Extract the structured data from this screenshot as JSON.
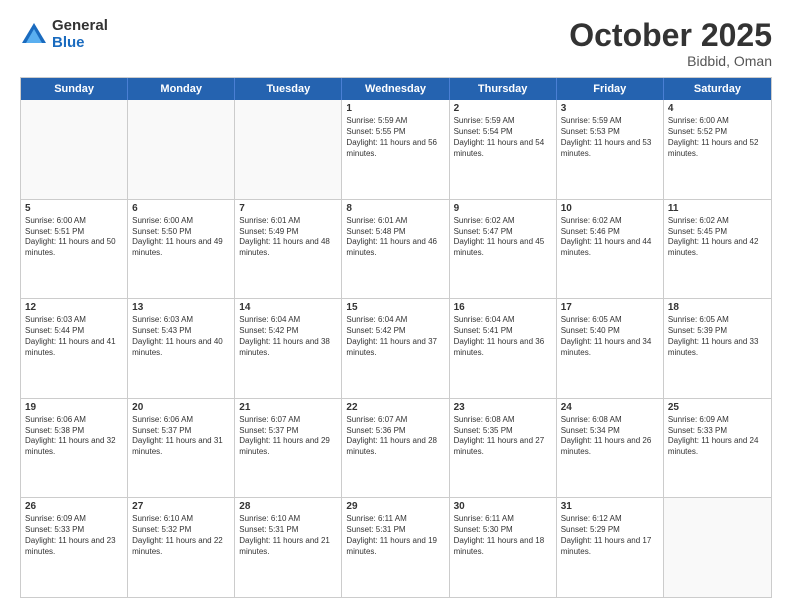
{
  "logo": {
    "general": "General",
    "blue": "Blue"
  },
  "header": {
    "month": "October 2025",
    "location": "Bidbid, Oman"
  },
  "days": [
    "Sunday",
    "Monday",
    "Tuesday",
    "Wednesday",
    "Thursday",
    "Friday",
    "Saturday"
  ],
  "weeks": [
    [
      {
        "day": "",
        "empty": true
      },
      {
        "day": "",
        "empty": true
      },
      {
        "day": "",
        "empty": true
      },
      {
        "day": "1",
        "sunrise": "Sunrise: 5:59 AM",
        "sunset": "Sunset: 5:55 PM",
        "daylight": "Daylight: 11 hours and 56 minutes."
      },
      {
        "day": "2",
        "sunrise": "Sunrise: 5:59 AM",
        "sunset": "Sunset: 5:54 PM",
        "daylight": "Daylight: 11 hours and 54 minutes."
      },
      {
        "day": "3",
        "sunrise": "Sunrise: 5:59 AM",
        "sunset": "Sunset: 5:53 PM",
        "daylight": "Daylight: 11 hours and 53 minutes."
      },
      {
        "day": "4",
        "sunrise": "Sunrise: 6:00 AM",
        "sunset": "Sunset: 5:52 PM",
        "daylight": "Daylight: 11 hours and 52 minutes."
      }
    ],
    [
      {
        "day": "5",
        "sunrise": "Sunrise: 6:00 AM",
        "sunset": "Sunset: 5:51 PM",
        "daylight": "Daylight: 11 hours and 50 minutes."
      },
      {
        "day": "6",
        "sunrise": "Sunrise: 6:00 AM",
        "sunset": "Sunset: 5:50 PM",
        "daylight": "Daylight: 11 hours and 49 minutes."
      },
      {
        "day": "7",
        "sunrise": "Sunrise: 6:01 AM",
        "sunset": "Sunset: 5:49 PM",
        "daylight": "Daylight: 11 hours and 48 minutes."
      },
      {
        "day": "8",
        "sunrise": "Sunrise: 6:01 AM",
        "sunset": "Sunset: 5:48 PM",
        "daylight": "Daylight: 11 hours and 46 minutes."
      },
      {
        "day": "9",
        "sunrise": "Sunrise: 6:02 AM",
        "sunset": "Sunset: 5:47 PM",
        "daylight": "Daylight: 11 hours and 45 minutes."
      },
      {
        "day": "10",
        "sunrise": "Sunrise: 6:02 AM",
        "sunset": "Sunset: 5:46 PM",
        "daylight": "Daylight: 11 hours and 44 minutes."
      },
      {
        "day": "11",
        "sunrise": "Sunrise: 6:02 AM",
        "sunset": "Sunset: 5:45 PM",
        "daylight": "Daylight: 11 hours and 42 minutes."
      }
    ],
    [
      {
        "day": "12",
        "sunrise": "Sunrise: 6:03 AM",
        "sunset": "Sunset: 5:44 PM",
        "daylight": "Daylight: 11 hours and 41 minutes."
      },
      {
        "day": "13",
        "sunrise": "Sunrise: 6:03 AM",
        "sunset": "Sunset: 5:43 PM",
        "daylight": "Daylight: 11 hours and 40 minutes."
      },
      {
        "day": "14",
        "sunrise": "Sunrise: 6:04 AM",
        "sunset": "Sunset: 5:42 PM",
        "daylight": "Daylight: 11 hours and 38 minutes."
      },
      {
        "day": "15",
        "sunrise": "Sunrise: 6:04 AM",
        "sunset": "Sunset: 5:42 PM",
        "daylight": "Daylight: 11 hours and 37 minutes."
      },
      {
        "day": "16",
        "sunrise": "Sunrise: 6:04 AM",
        "sunset": "Sunset: 5:41 PM",
        "daylight": "Daylight: 11 hours and 36 minutes."
      },
      {
        "day": "17",
        "sunrise": "Sunrise: 6:05 AM",
        "sunset": "Sunset: 5:40 PM",
        "daylight": "Daylight: 11 hours and 34 minutes."
      },
      {
        "day": "18",
        "sunrise": "Sunrise: 6:05 AM",
        "sunset": "Sunset: 5:39 PM",
        "daylight": "Daylight: 11 hours and 33 minutes."
      }
    ],
    [
      {
        "day": "19",
        "sunrise": "Sunrise: 6:06 AM",
        "sunset": "Sunset: 5:38 PM",
        "daylight": "Daylight: 11 hours and 32 minutes."
      },
      {
        "day": "20",
        "sunrise": "Sunrise: 6:06 AM",
        "sunset": "Sunset: 5:37 PM",
        "daylight": "Daylight: 11 hours and 31 minutes."
      },
      {
        "day": "21",
        "sunrise": "Sunrise: 6:07 AM",
        "sunset": "Sunset: 5:37 PM",
        "daylight": "Daylight: 11 hours and 29 minutes."
      },
      {
        "day": "22",
        "sunrise": "Sunrise: 6:07 AM",
        "sunset": "Sunset: 5:36 PM",
        "daylight": "Daylight: 11 hours and 28 minutes."
      },
      {
        "day": "23",
        "sunrise": "Sunrise: 6:08 AM",
        "sunset": "Sunset: 5:35 PM",
        "daylight": "Daylight: 11 hours and 27 minutes."
      },
      {
        "day": "24",
        "sunrise": "Sunrise: 6:08 AM",
        "sunset": "Sunset: 5:34 PM",
        "daylight": "Daylight: 11 hours and 26 minutes."
      },
      {
        "day": "25",
        "sunrise": "Sunrise: 6:09 AM",
        "sunset": "Sunset: 5:33 PM",
        "daylight": "Daylight: 11 hours and 24 minutes."
      }
    ],
    [
      {
        "day": "26",
        "sunrise": "Sunrise: 6:09 AM",
        "sunset": "Sunset: 5:33 PM",
        "daylight": "Daylight: 11 hours and 23 minutes."
      },
      {
        "day": "27",
        "sunrise": "Sunrise: 6:10 AM",
        "sunset": "Sunset: 5:32 PM",
        "daylight": "Daylight: 11 hours and 22 minutes."
      },
      {
        "day": "28",
        "sunrise": "Sunrise: 6:10 AM",
        "sunset": "Sunset: 5:31 PM",
        "daylight": "Daylight: 11 hours and 21 minutes."
      },
      {
        "day": "29",
        "sunrise": "Sunrise: 6:11 AM",
        "sunset": "Sunset: 5:31 PM",
        "daylight": "Daylight: 11 hours and 19 minutes."
      },
      {
        "day": "30",
        "sunrise": "Sunrise: 6:11 AM",
        "sunset": "Sunset: 5:30 PM",
        "daylight": "Daylight: 11 hours and 18 minutes."
      },
      {
        "day": "31",
        "sunrise": "Sunrise: 6:12 AM",
        "sunset": "Sunset: 5:29 PM",
        "daylight": "Daylight: 11 hours and 17 minutes."
      },
      {
        "day": "",
        "empty": true
      }
    ]
  ]
}
